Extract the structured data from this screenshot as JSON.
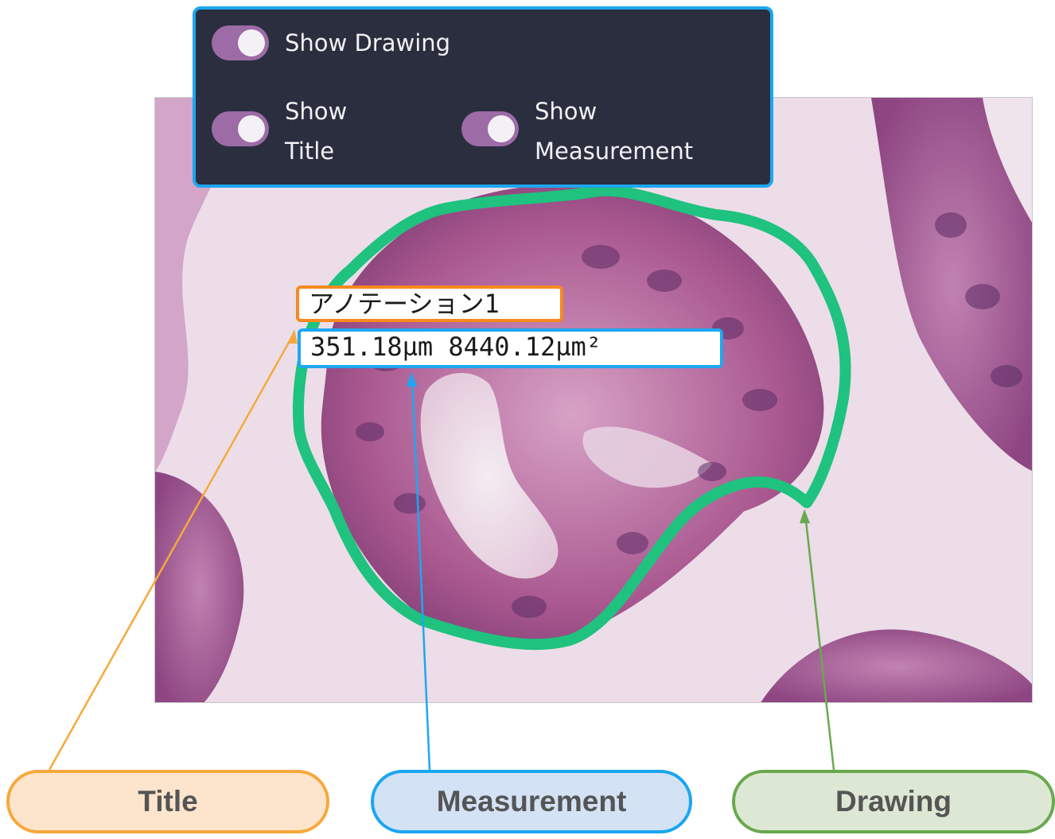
{
  "toggles": {
    "show_drawing": {
      "label": "Show Drawing",
      "on": true
    },
    "show_title": {
      "line1": "Show",
      "line2": "Title",
      "on": true
    },
    "show_measurement": {
      "line1": "Show",
      "line2": "Measurement",
      "on": true
    }
  },
  "annotation": {
    "title": "アノテーション1",
    "measurement": "351.18µm 8440.12µm²"
  },
  "callouts": {
    "title": "Title",
    "measurement": "Measurement",
    "drawing": "Drawing"
  },
  "colors": {
    "panel_bg": "#2b2e3f",
    "panel_border": "#1ea7f0",
    "toggle_on": "#9d6ba6",
    "drawing_outline": "#1fc27e",
    "title_accent": "#f6891f",
    "measurement_accent": "#1ea7f0",
    "drawing_accent": "#6aa84f"
  }
}
